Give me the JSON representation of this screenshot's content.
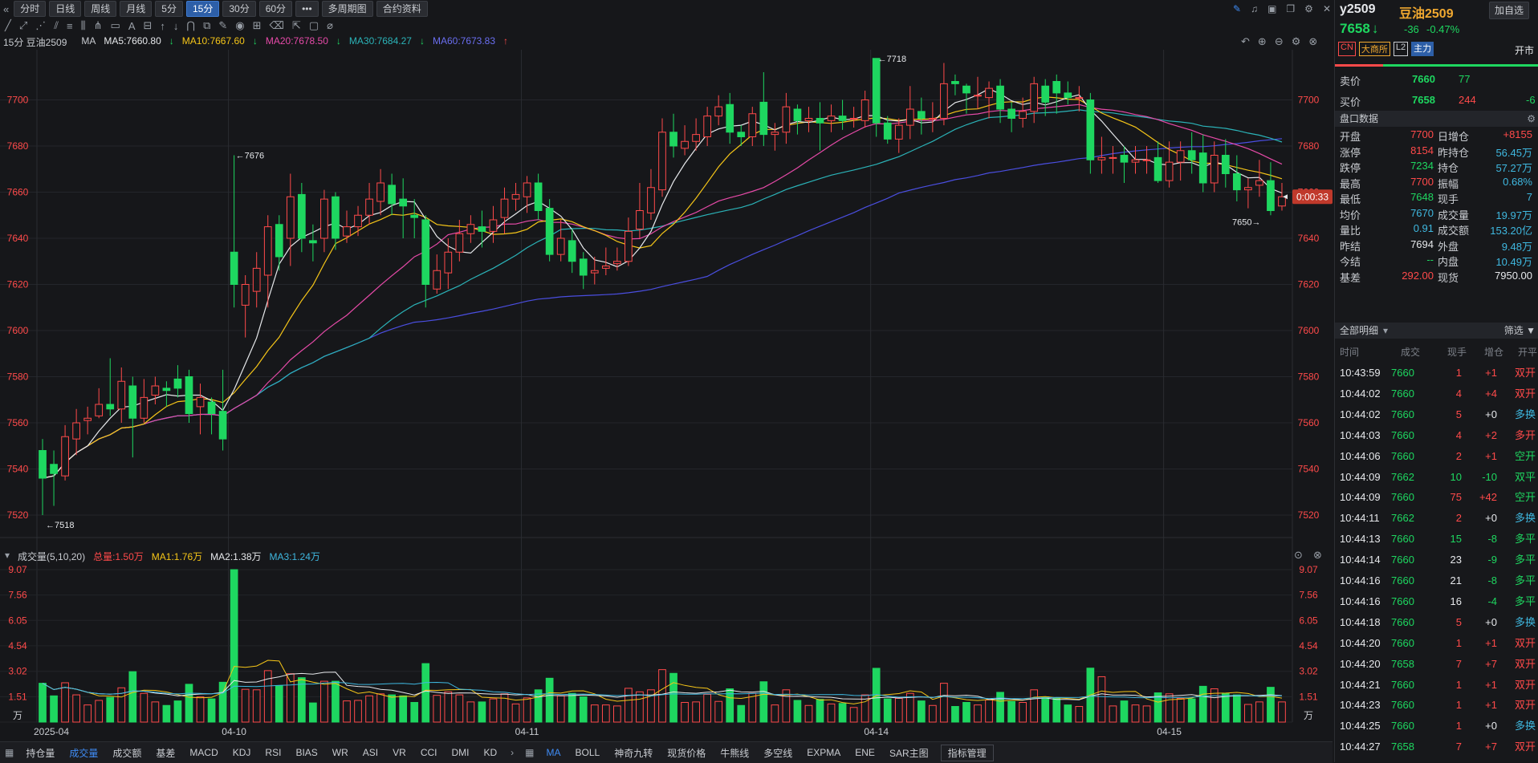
{
  "toolbar": {
    "buttons": [
      "分时",
      "日线",
      "周线",
      "月线",
      "5分",
      "15分",
      "30分",
      "60分",
      "•••",
      "多周期图",
      "合约资料"
    ],
    "active": "15分"
  },
  "legend": {
    "title": "15分 豆油2509",
    "ma_label": "MA",
    "ma5": "MA5:7660.80",
    "ma10": "MA10:7667.60",
    "ma20": "MA20:7678.50",
    "ma30": "MA30:7684.27",
    "ma60": "MA60:7673.83"
  },
  "volume_legend": {
    "title": "成交量(5,10,20)",
    "total": "总量:1.50万",
    "ma1": "MA1:1.76万",
    "ma2": "MA2:1.38万",
    "ma3": "MA3:1.24万"
  },
  "colors": {
    "up": "#ff4a4a",
    "down": "#1ed760",
    "ma5": "#e6e8eb",
    "ma10": "#f5c518",
    "ma20": "#e64aa8",
    "ma30": "#2bb3b8",
    "ma60": "#4a4ee0"
  },
  "price_axis": [
    "7700",
    "7680",
    "7660",
    "7640",
    "7620",
    "7600",
    "7580",
    "7560",
    "7540",
    "7520"
  ],
  "volume_axis": [
    "9.07",
    "7.56",
    "6.05",
    "4.54",
    "3.02",
    "1.51",
    "万"
  ],
  "date_axis": [
    "2025-04",
    "04-10",
    "04-11",
    "04-14",
    "04-15"
  ],
  "annotations": {
    "low": "7518",
    "hi1": "7676",
    "hi2": "7718",
    "last_low": "7650",
    "countdown": "0:00:33"
  },
  "chart_data": {
    "type": "candlestick",
    "period": "15分",
    "candles": [
      [
        7548,
        7536,
        7553,
        7520
      ],
      [
        7542,
        7538,
        7548,
        7524
      ],
      [
        7537,
        7554,
        7559,
        7535
      ],
      [
        7553,
        7560,
        7566,
        7546
      ],
      [
        7561,
        7562,
        7567,
        7555
      ],
      [
        7563,
        7568,
        7575,
        7562
      ],
      [
        7568,
        7566,
        7588,
        7563
      ],
      [
        7566,
        7578,
        7584,
        7560
      ],
      [
        7576,
        7562,
        7580,
        7545
      ],
      [
        7562,
        7571,
        7579,
        7560
      ],
      [
        7572,
        7576,
        7580,
        7568
      ],
      [
        7575,
        7574,
        7578,
        7567
      ],
      [
        7579,
        7575,
        7585,
        7571
      ],
      [
        7580,
        7564,
        7583,
        7560
      ],
      [
        7567,
        7571,
        7577,
        7555
      ],
      [
        7569,
        7564,
        7571,
        7555
      ],
      [
        7565,
        7553,
        7583,
        7548
      ],
      [
        7634,
        7620,
        7676,
        7610
      ],
      [
        7611,
        7620,
        7624,
        7597
      ],
      [
        7617,
        7627,
        7634,
        7610
      ],
      [
        7624,
        7645,
        7650,
        7610
      ],
      [
        7646,
        7632,
        7650,
        7626
      ],
      [
        7640,
        7658,
        7668,
        7628
      ],
      [
        7659,
        7640,
        7664,
        7634
      ],
      [
        7639,
        7638,
        7646,
        7630
      ],
      [
        7640,
        7657,
        7661,
        7634
      ],
      [
        7658,
        7640,
        7660,
        7635
      ],
      [
        7641,
        7645,
        7652,
        7638
      ],
      [
        7645,
        7650,
        7654,
        7641
      ],
      [
        7650,
        7657,
        7664,
        7646
      ],
      [
        7656,
        7664,
        7670,
        7650
      ],
      [
        7663,
        7655,
        7668,
        7650
      ],
      [
        7657,
        7654,
        7666,
        7640
      ],
      [
        7650,
        7649,
        7657,
        7640
      ],
      [
        7648,
        7620,
        7650,
        7610
      ],
      [
        7618,
        7626,
        7633,
        7616
      ],
      [
        7625,
        7634,
        7640,
        7618
      ],
      [
        7634,
        7642,
        7648,
        7630
      ],
      [
        7642,
        7646,
        7650,
        7638
      ],
      [
        7645,
        7643,
        7652,
        7636
      ],
      [
        7643,
        7648,
        7654,
        7638
      ],
      [
        7649,
        7657,
        7662,
        7642
      ],
      [
        7657,
        7659,
        7664,
        7652
      ],
      [
        7658,
        7664,
        7667,
        7651
      ],
      [
        7664,
        7652,
        7668,
        7648
      ],
      [
        7653,
        7633,
        7657,
        7630
      ],
      [
        7633,
        7640,
        7648,
        7630
      ],
      [
        7639,
        7630,
        7644,
        7625
      ],
      [
        7631,
        7624,
        7634,
        7618
      ],
      [
        7625,
        7626,
        7632,
        7620
      ],
      [
        7627,
        7628,
        7636,
        7624
      ],
      [
        7629,
        7630,
        7636,
        7626
      ],
      [
        7630,
        7643,
        7649,
        7628
      ],
      [
        7644,
        7652,
        7664,
        7640
      ],
      [
        7651,
        7662,
        7670,
        7648
      ],
      [
        7661,
        7686,
        7692,
        7658
      ],
      [
        7686,
        7680,
        7694,
        7675
      ],
      [
        7679,
        7682,
        7689,
        7676
      ],
      [
        7682,
        7685,
        7692,
        7678
      ],
      [
        7684,
        7693,
        7697,
        7680
      ],
      [
        7693,
        7697,
        7702,
        7689
      ],
      [
        7698,
        7686,
        7703,
        7681
      ],
      [
        7686,
        7684,
        7689,
        7680
      ],
      [
        7684,
        7694,
        7697,
        7680
      ],
      [
        7699,
        7685,
        7712,
        7680
      ],
      [
        7685,
        7686,
        7690,
        7678
      ],
      [
        7686,
        7697,
        7703,
        7681
      ],
      [
        7696,
        7691,
        7698,
        7685
      ],
      [
        7691,
        7692,
        7697,
        7686
      ],
      [
        7692,
        7690,
        7699,
        7678
      ],
      [
        7691,
        7693,
        7698,
        7686
      ],
      [
        7693,
        7691,
        7700,
        7687
      ],
      [
        7692,
        7692,
        7697,
        7688
      ],
      [
        7691,
        7700,
        7704,
        7688
      ],
      [
        7718,
        7690,
        7718,
        7684
      ],
      [
        7690,
        7683,
        7693,
        7681
      ],
      [
        7683,
        7689,
        7692,
        7677
      ],
      [
        7689,
        7696,
        7706,
        7683
      ],
      [
        7695,
        7692,
        7701,
        7685
      ],
      [
        7692,
        7692,
        7699,
        7686
      ],
      [
        7692,
        7707,
        7716,
        7689
      ],
      [
        7708,
        7707,
        7711,
        7702
      ],
      [
        7706,
        7703,
        7707,
        7694
      ],
      [
        7702,
        7702,
        7710,
        7696
      ],
      [
        7701,
        7705,
        7708,
        7692
      ],
      [
        7706,
        7696,
        7709,
        7690
      ],
      [
        7696,
        7692,
        7699,
        7686
      ],
      [
        7692,
        7695,
        7701,
        7688
      ],
      [
        7695,
        7707,
        7710,
        7690
      ],
      [
        7706,
        7699,
        7709,
        7693
      ],
      [
        7708,
        7703,
        7711,
        7694
      ],
      [
        7703,
        7701,
        7708,
        7698
      ],
      [
        7701,
        7701,
        7706,
        7695
      ],
      [
        7700,
        7674,
        7703,
        7668
      ],
      [
        7674,
        7675,
        7684,
        7668
      ],
      [
        7675,
        7675,
        7680,
        7668
      ],
      [
        7676,
        7673,
        7680,
        7664
      ],
      [
        7673,
        7674,
        7680,
        7668
      ],
      [
        7674,
        7674,
        7680,
        7668
      ],
      [
        7675,
        7665,
        7682,
        7664
      ],
      [
        7665,
        7673,
        7682,
        7662
      ],
      [
        7673,
        7678,
        7682,
        7665
      ],
      [
        7678,
        7674,
        7686,
        7668
      ],
      [
        7677,
        7664,
        7685,
        7660
      ],
      [
        7664,
        7676,
        7682,
        7660
      ],
      [
        7676,
        7668,
        7683,
        7662
      ],
      [
        7668,
        7661,
        7676,
        7656
      ],
      [
        7661,
        7662,
        7666,
        7653
      ],
      [
        7663,
        7665,
        7674,
        7658
      ],
      [
        7665,
        7652,
        7673,
        7650
      ],
      [
        7654,
        7658,
        7664,
        7652
      ]
    ]
  },
  "panel": {
    "symbol": "y2509",
    "name": "豆油2509",
    "add_fav": "加自选",
    "price": "7658",
    "arrow": "↓",
    "change": "-36",
    "change_pct": "-0.47%",
    "tags": [
      "CN",
      "大商所",
      "L2",
      "主力"
    ],
    "status": "开市",
    "ask_label": "卖价",
    "ask": "7660",
    "ask_vol": "77",
    "bid_label": "买价",
    "bid": "7658",
    "bid_vol": "244",
    "bid_delta": "-6",
    "pankou_title": "盘口数据",
    "quotes": [
      [
        "开盘",
        "7700",
        "日增仓",
        "+8155"
      ],
      [
        "涨停",
        "8154",
        "昨持仓",
        "56.45万"
      ],
      [
        "跌停",
        "7234",
        "持仓",
        "57.27万"
      ],
      [
        "最高",
        "7700",
        "振幅",
        "0.68%"
      ],
      [
        "最低",
        "7648",
        "现手",
        "7"
      ],
      [
        "均价",
        "7670",
        "成交量",
        "19.97万"
      ],
      [
        "量比",
        "0.91",
        "成交额",
        "153.20亿"
      ],
      [
        "昨结",
        "7694",
        "外盘",
        "9.48万"
      ],
      [
        "今结",
        "--",
        "内盘",
        "10.49万"
      ],
      [
        "基差",
        "292.00",
        "现货",
        "7950.00"
      ]
    ],
    "detail_title": "全部明细",
    "filter": "筛选",
    "detail_headers": [
      "时间",
      "成交",
      "现手",
      "增仓",
      "开平"
    ],
    "trades": [
      [
        "10:43:59",
        "7660",
        "1",
        "+1",
        "双开"
      ],
      [
        "10:44:02",
        "7660",
        "4",
        "+4",
        "双开"
      ],
      [
        "10:44:02",
        "7660",
        "5",
        "+0",
        "多换"
      ],
      [
        "10:44:03",
        "7660",
        "4",
        "+2",
        "多开"
      ],
      [
        "10:44:06",
        "7660",
        "2",
        "+1",
        "空开"
      ],
      [
        "10:44:09",
        "7662",
        "10",
        "-10",
        "双平"
      ],
      [
        "10:44:09",
        "7660",
        "75",
        "+42",
        "空开"
      ],
      [
        "10:44:11",
        "7662",
        "2",
        "+0",
        "多换"
      ],
      [
        "10:44:13",
        "7660",
        "15",
        "-8",
        "多平"
      ],
      [
        "10:44:14",
        "7660",
        "23",
        "-9",
        "多平"
      ],
      [
        "10:44:16",
        "7660",
        "21",
        "-8",
        "多平"
      ],
      [
        "10:44:16",
        "7660",
        "16",
        "-4",
        "多平"
      ],
      [
        "10:44:18",
        "7660",
        "5",
        "+0",
        "多换"
      ],
      [
        "10:44:20",
        "7660",
        "1",
        "+1",
        "双开"
      ],
      [
        "10:44:20",
        "7658",
        "7",
        "+7",
        "双开"
      ],
      [
        "10:44:21",
        "7660",
        "1",
        "+1",
        "双开"
      ],
      [
        "10:44:23",
        "7660",
        "1",
        "+1",
        "双开"
      ],
      [
        "10:44:25",
        "7660",
        "1",
        "+0",
        "多换"
      ],
      [
        "10:44:27",
        "7658",
        "7",
        "+7",
        "双开"
      ]
    ]
  },
  "bottom_tabs": [
    "持仓量",
    "成交量",
    "成交额",
    "基差",
    "MACD",
    "KDJ",
    "RSI",
    "BIAS",
    "WR",
    "ASI",
    "VR",
    "CCI",
    "DMI",
    "KD",
    "MA",
    "BOLL",
    "神奇九转",
    "现货价格",
    "牛熊线",
    "多空线",
    "EXPMA",
    "ENE",
    "SAR主图",
    "指标管理"
  ]
}
